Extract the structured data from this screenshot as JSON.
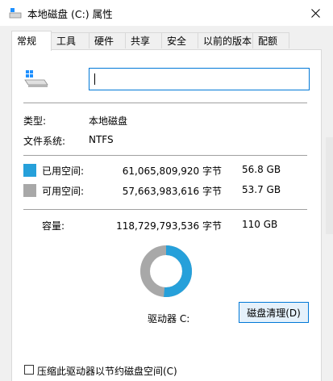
{
  "window": {
    "title": "本地磁盘 (C:) 属性",
    "close_glyph": "✕"
  },
  "tabs": [
    "常规",
    "工具",
    "硬件",
    "共享",
    "安全",
    "以前的版本",
    "配额"
  ],
  "active_tab": "常规",
  "general": {
    "volume_name": "",
    "type_label": "类型:",
    "type_value": "本地磁盘",
    "fs_label": "文件系统:",
    "fs_value": "NTFS",
    "used": {
      "label": "已用空间:",
      "bytes": "61,065,809,920 字节",
      "size": "56.8 GB",
      "color": "#26a0da"
    },
    "free": {
      "label": "可用空间:",
      "bytes": "57,663,983,616 字节",
      "size": "53.7 GB",
      "color": "#a8a8a8"
    },
    "capacity": {
      "label": "容量:",
      "bytes": "118,729,793,536 字节",
      "size": "110 GB"
    },
    "drive_label": "驱动器 C:",
    "cleanup_button": "磁盘清理(D)",
    "compress_label": "压缩此驱动器以节约磁盘空间(C)",
    "compress_checked": false,
    "used_fraction": 0.514
  },
  "icons": {
    "title": "drive-icon",
    "large": "drive-icon",
    "close": "close-icon"
  }
}
